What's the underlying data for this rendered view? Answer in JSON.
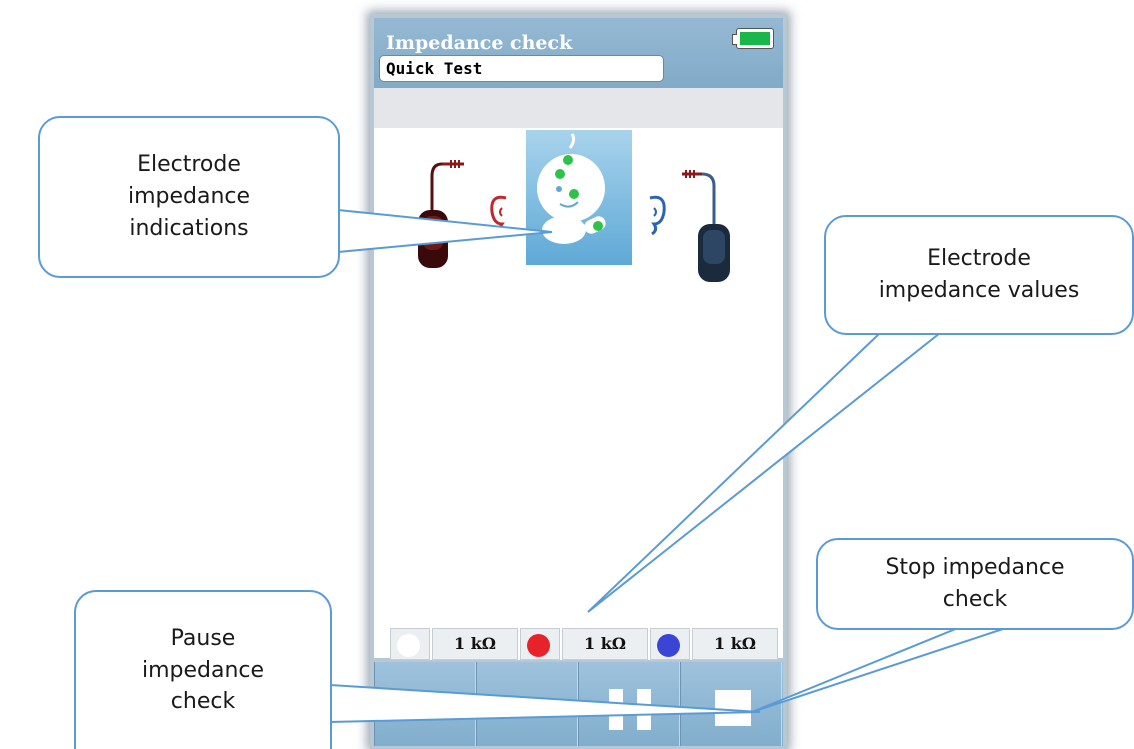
{
  "screen": {
    "title": "Impedance check",
    "test_name": "Quick Test",
    "battery_color": "#19b64a"
  },
  "electrodes": [
    {
      "color": "#ffffff",
      "value": "1 kΩ"
    },
    {
      "color": "#e8222a",
      "value": "1 kΩ"
    },
    {
      "color": "#3a45d6",
      "value": "1 kΩ"
    }
  ],
  "toolbar": {
    "buttons": [
      "",
      "",
      "pause-icon",
      "stop-icon"
    ]
  },
  "callouts": {
    "indications": "Electrode impedance indications",
    "values": "Electrode impedance values",
    "pause": "Pause impedance check",
    "stop": "Stop impedance check"
  },
  "colors": {
    "left_ear": "#c0282c",
    "right_ear": "#2c64b0",
    "good_electrode": "#2fc14a",
    "callout_border": "#5b9bd5"
  }
}
